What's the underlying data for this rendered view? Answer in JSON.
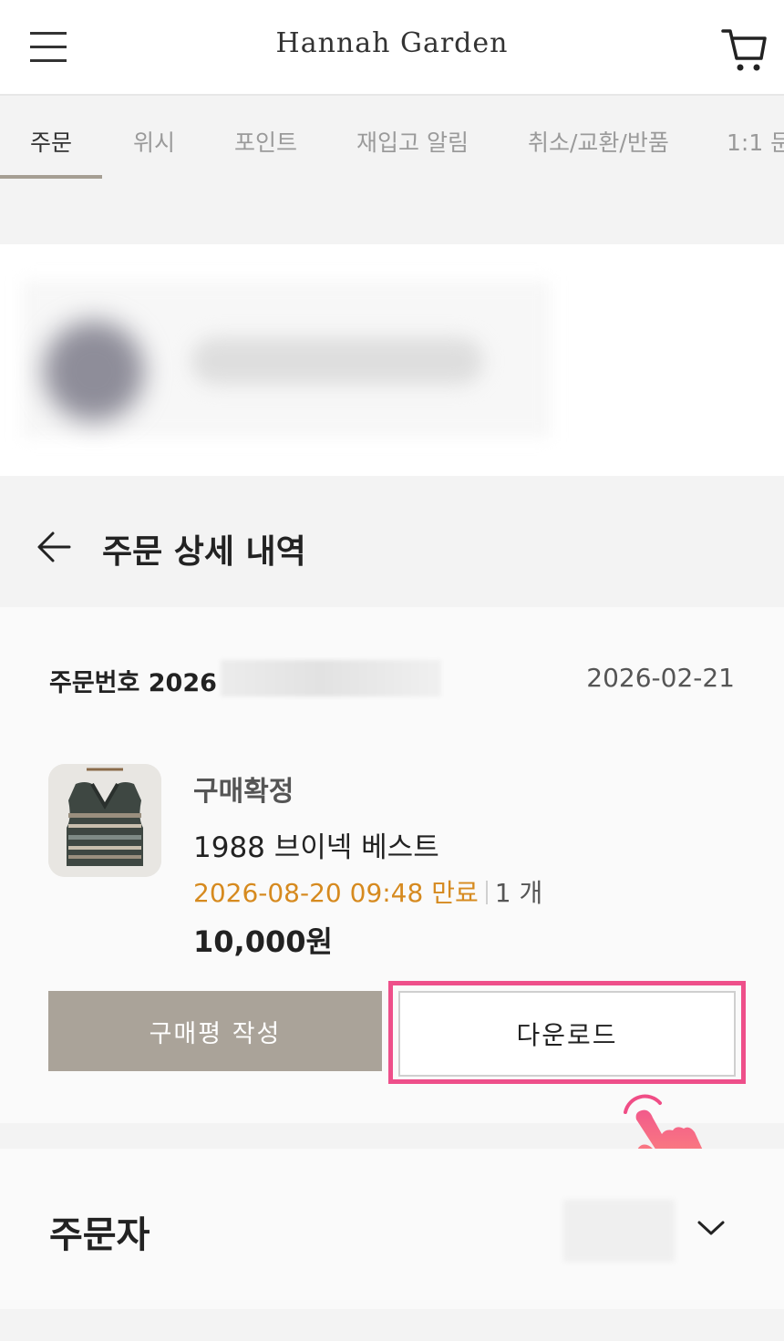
{
  "header": {
    "brand": "Hannah Garden",
    "menu_icon": "hamburger-menu-icon",
    "cart_icon": "shopping-cart-icon"
  },
  "tabs": [
    {
      "label": "주문",
      "active": true
    },
    {
      "label": "위시",
      "active": false
    },
    {
      "label": "포인트",
      "active": false
    },
    {
      "label": "재입고 알림",
      "active": false
    },
    {
      "label": "취소/교환/반품",
      "active": false
    },
    {
      "label": "1:1 문",
      "active": false
    }
  ],
  "detail": {
    "back_icon": "arrow-left-icon",
    "title": "주문 상세 내역"
  },
  "order": {
    "number_prefix": "주문번호 2026",
    "date": "2026-02-21",
    "status": "구매확정",
    "product_name": "1988 브이넥 베스트",
    "expire": "2026-08-20 09:48 만료",
    "quantity": "1 개",
    "price": "10,000원",
    "review_button": "구매평 작성",
    "download_button": "다운로드"
  },
  "orderer": {
    "title": "주문자",
    "chevron_icon": "chevron-down-icon"
  },
  "colors": {
    "accent": "#a59e93",
    "review_button_bg": "#aaa399",
    "expire_text": "#d68a1f",
    "highlight": "#ee4f8a"
  },
  "overlay": {
    "pointer_icon": "tap-hand-icon"
  }
}
